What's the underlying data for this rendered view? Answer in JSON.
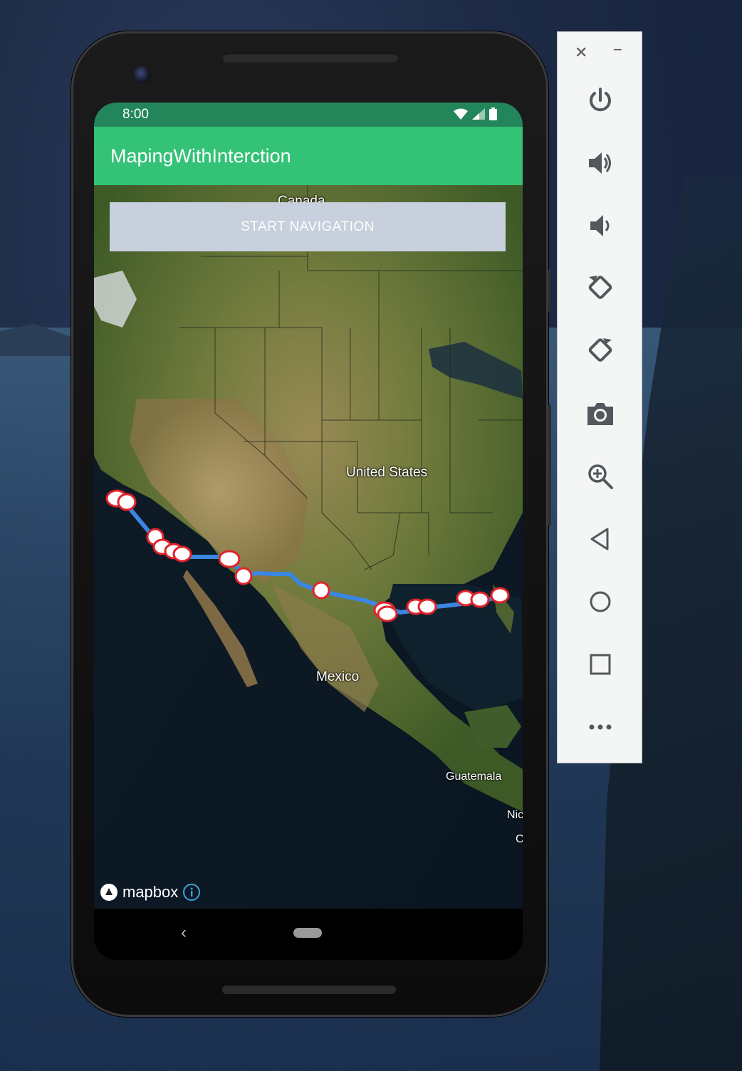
{
  "status_bar": {
    "time": "8:00"
  },
  "app": {
    "title": "MapingWithInterction"
  },
  "map": {
    "button_label": "START NAVIGATION",
    "labels": {
      "canada": "Canada",
      "united_states": "United States",
      "mexico": "Mexico",
      "guatemala": "Guatemala",
      "nic": "Nic",
      "c": "C"
    },
    "attribution": "mapbox",
    "colors": {
      "route": "#3b86e0",
      "marker_border": "#e0232a",
      "marker_fill": "#ffffff"
    }
  },
  "emulator_toolbar": {
    "items": [
      "close-icon",
      "minimize-icon",
      "power-icon",
      "volume-up-icon",
      "volume-down-icon",
      "rotate-left-icon",
      "rotate-right-icon",
      "camera-icon",
      "zoom-icon",
      "back-icon",
      "home-icon",
      "overview-icon",
      "more-icon"
    ]
  }
}
